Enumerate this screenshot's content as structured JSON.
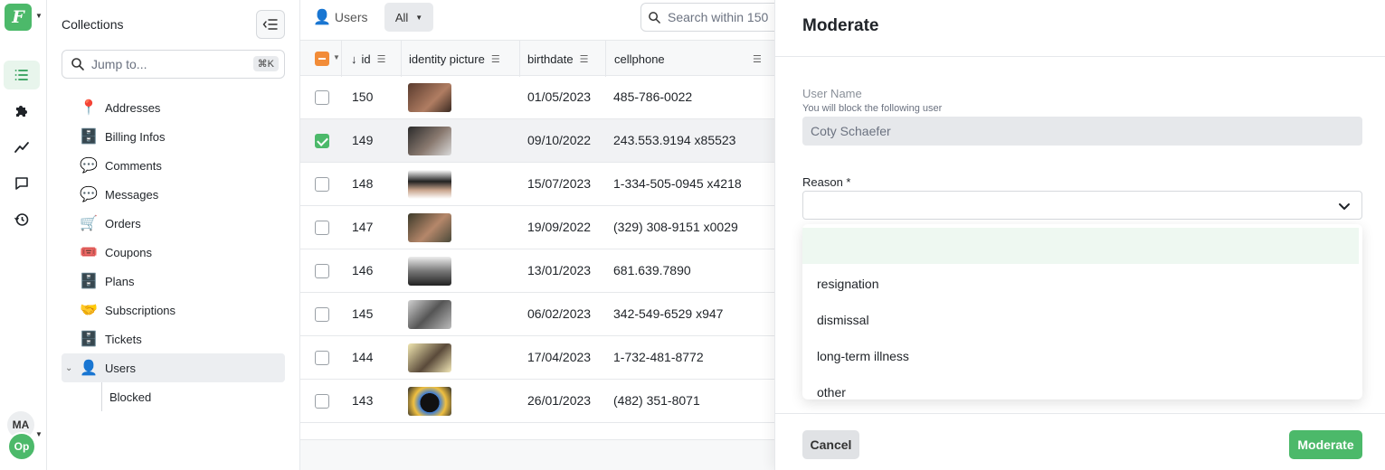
{
  "rail": {
    "logo": "F",
    "items": [
      {
        "icon": "list-icon",
        "active": true
      },
      {
        "icon": "puzzle-icon",
        "active": false
      },
      {
        "icon": "chart-icon",
        "active": false
      },
      {
        "icon": "chat-icon",
        "active": false
      },
      {
        "icon": "history-icon",
        "active": false
      }
    ],
    "user_initials": "MA",
    "org_initials": "Op"
  },
  "sidebar": {
    "title": "Collections",
    "jump_placeholder": "Jump to...",
    "jump_shortcut": "⌘K",
    "items": [
      {
        "emoji": "📍",
        "label": "Addresses"
      },
      {
        "emoji": "🗄️",
        "label": "Billing Infos"
      },
      {
        "emoji": "💬",
        "label": "Comments"
      },
      {
        "emoji": "💬",
        "label": "Messages"
      },
      {
        "emoji": "🛒",
        "label": "Orders"
      },
      {
        "emoji": "🎟️",
        "label": "Coupons"
      },
      {
        "emoji": "🗄️",
        "label": "Plans"
      },
      {
        "emoji": "🤝",
        "label": "Subscriptions"
      },
      {
        "emoji": "🗄️",
        "label": "Tickets"
      },
      {
        "emoji": "👤",
        "label": "Users"
      }
    ],
    "sub_items": [
      {
        "label": "Blocked"
      }
    ]
  },
  "table": {
    "tab_label": "Users",
    "tab_emoji": "👤",
    "filter_label": "All",
    "search_placeholder": "Search within 150",
    "columns": [
      "id",
      "identity picture",
      "birthdate",
      "cellphone"
    ],
    "rows": [
      {
        "id": "150",
        "birthdate": "01/05/2023",
        "cellphone": "485-786-0022",
        "selected": false
      },
      {
        "id": "149",
        "birthdate": "09/10/2022",
        "cellphone": "243.553.9194 x85523",
        "selected": true
      },
      {
        "id": "148",
        "birthdate": "15/07/2023",
        "cellphone": "1-334-505-0945 x4218",
        "selected": false
      },
      {
        "id": "147",
        "birthdate": "19/09/2022",
        "cellphone": "(329) 308-9151 x0029",
        "selected": false
      },
      {
        "id": "146",
        "birthdate": "13/01/2023",
        "cellphone": "681.639.7890",
        "selected": false
      },
      {
        "id": "145",
        "birthdate": "06/02/2023",
        "cellphone": "342-549-6529 x947",
        "selected": false
      },
      {
        "id": "144",
        "birthdate": "17/04/2023",
        "cellphone": "1-732-481-8772",
        "selected": false
      },
      {
        "id": "143",
        "birthdate": "26/01/2023",
        "cellphone": "(482) 351-8071",
        "selected": false
      }
    ]
  },
  "panel": {
    "title": "Moderate",
    "user_label": "User Name",
    "user_help": "You will block the following user",
    "user_value": "Coty Schaefer",
    "reason_label": "Reason *",
    "options": [
      "",
      "resignation",
      "dismissal",
      "long-term illness",
      "other"
    ],
    "cancel": "Cancel",
    "submit": "Moderate"
  },
  "colors": {
    "accent": "#4cb96a",
    "header_checkbox": "#f28c38"
  }
}
